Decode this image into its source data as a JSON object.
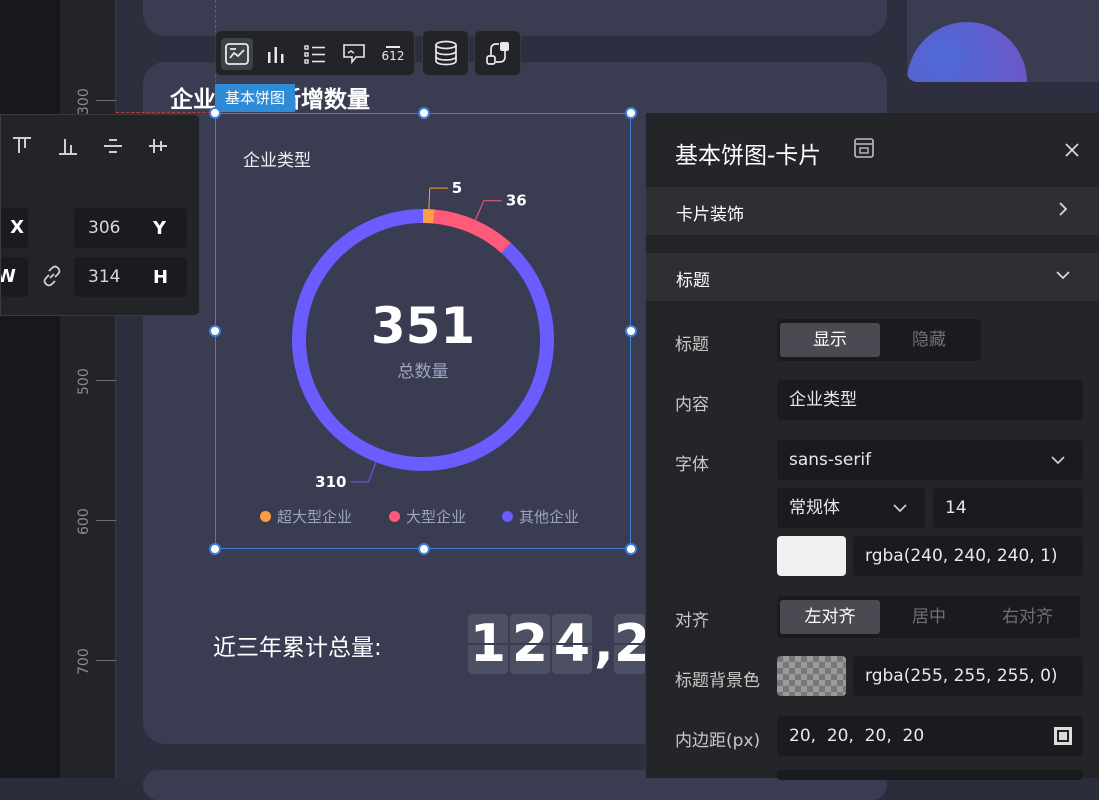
{
  "ruler": {
    "labels": [
      "300",
      "500",
      "600",
      "700"
    ]
  },
  "card": {
    "title_left": "企业",
    "title_right": "新增数量"
  },
  "toolbar": {
    "badge": "612"
  },
  "selection": {
    "label": "基本饼图"
  },
  "chart_data": {
    "type": "pie",
    "title": "企业类型",
    "center_value": "351",
    "center_label": "总数量",
    "categories": [
      "超大型企业",
      "大型企业",
      "其他企业"
    ],
    "values": [
      5,
      36,
      310
    ],
    "colors": [
      "#ff9b45",
      "#ff5a7a",
      "#6a5cff"
    ],
    "legend_position": "bottom"
  },
  "counter": {
    "label": "近三年累计总量:",
    "digits": [
      "1",
      "2",
      "4",
      ",",
      "2"
    ]
  },
  "position": {
    "x_label": "X",
    "y_label": "Y",
    "y_value": "306",
    "w_label": "W",
    "h_label": "H",
    "h_value": "314"
  },
  "panel": {
    "title": "基本饼图-卡片",
    "section_deco": "卡片装饰",
    "section_title": "标题",
    "fields": {
      "title_label": "标题",
      "title_show": "显示",
      "title_hide": "隐藏",
      "content_label": "内容",
      "content_value": "企业类型",
      "font_label": "字体",
      "font_value": "sans-serif",
      "weight_value": "常规体",
      "size_value": "14",
      "color_value": "rgba(240, 240, 240, 1)",
      "align_label": "对齐",
      "align_left": "左对齐",
      "align_center": "居中",
      "align_right": "右对齐",
      "bg_label": "标题背景色",
      "bg_value": "rgba(255, 255, 255, 0)",
      "padding_label": "内边距(px)",
      "padding_value": "20,  20,  20,  20"
    }
  },
  "colors": {
    "accent": "#2f8bd6",
    "selection": "#3d7fd6"
  }
}
